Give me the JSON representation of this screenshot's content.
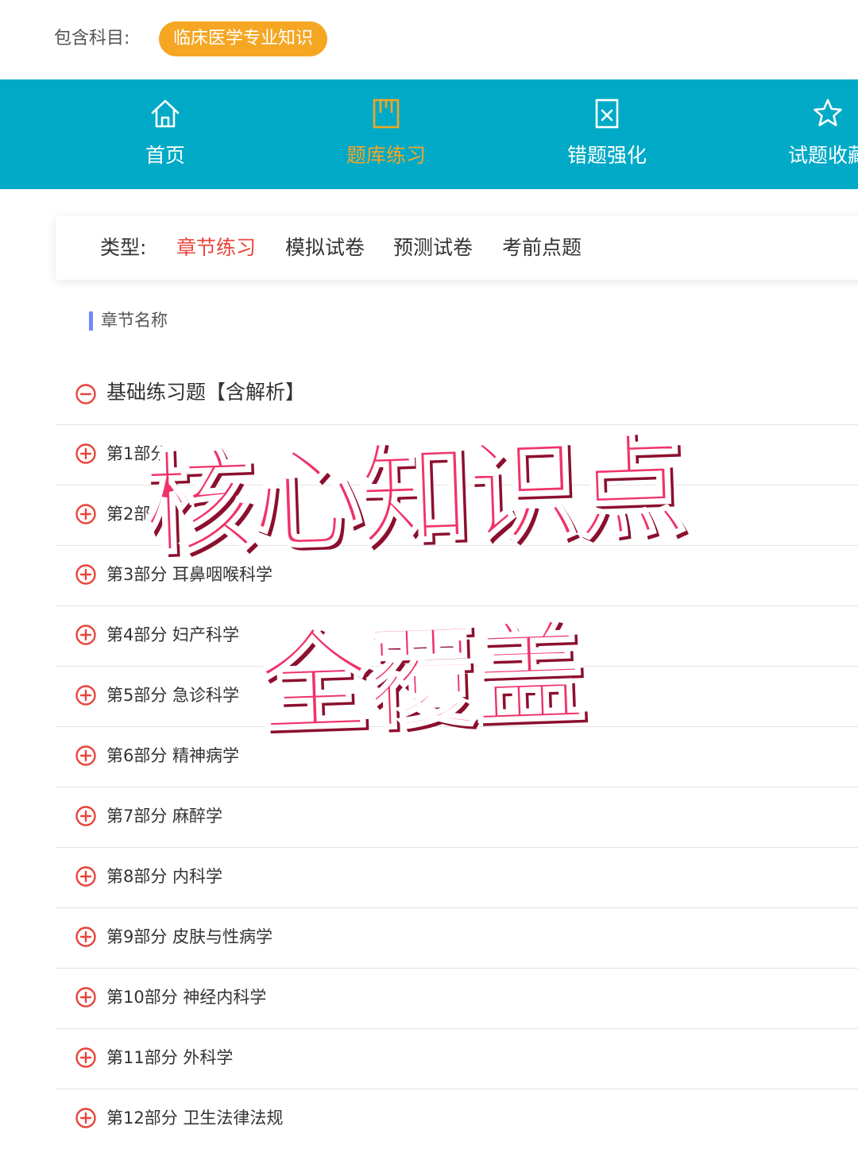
{
  "subject": {
    "label": "包含科目:",
    "chip": "临床医学专业知识",
    "chip_color": "#f5a623"
  },
  "nav": {
    "background": "#00aac7",
    "items": [
      {
        "label": "首页",
        "icon": "home-icon",
        "active": false
      },
      {
        "label": "题库练习",
        "icon": "book-icon",
        "active": true
      },
      {
        "label": "错题强化",
        "icon": "wrong-question-icon",
        "active": false
      },
      {
        "label": "试题收藏",
        "icon": "star-icon",
        "active": false
      }
    ]
  },
  "type_filter": {
    "label": "类型:",
    "options": [
      "章节练习",
      "模拟试卷",
      "预测试卷",
      "考前点题"
    ],
    "selected": "章节练习",
    "active_color": "#e8453c"
  },
  "chapter_header": "章节名称",
  "group": {
    "title": "基础练习题【含解析】",
    "expanded": true,
    "icon": "collapse-circle-icon"
  },
  "chapters": [
    "第1部分 ",
    "第2部分 ",
    "第3部分 耳鼻咽喉科学",
    "第4部分 妇产科学",
    "第5部分 急诊科学",
    "第6部分 精神病学",
    "第7部分 麻醉学",
    "第8部分 内科学",
    "第9部分 皮肤与性病学",
    "第10部分 神经内科学",
    "第11部分 外科学",
    "第12部分 卫生法律法规"
  ],
  "overlay": {
    "line1": "核心知识点",
    "line2": "全覆盖",
    "color": "#f0326a"
  }
}
